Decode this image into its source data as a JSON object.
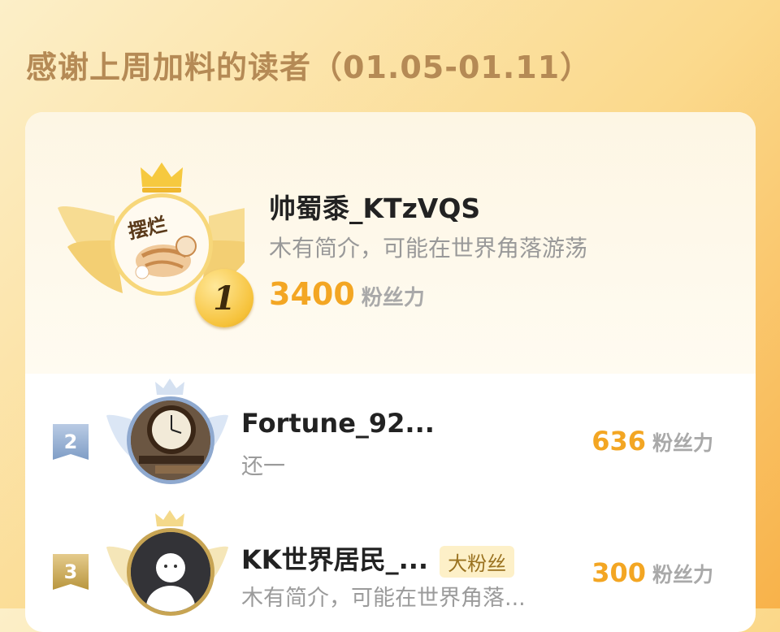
{
  "header": {
    "title": "感谢上周加料的读者（01.05-01.11）"
  },
  "first": {
    "rank": "1",
    "name": "帅蜀黍_KTzVQS",
    "bio": "木有简介，可能在世界角落游荡",
    "score": "3400",
    "score_unit": "粉丝力",
    "avatar_text": "摆烂"
  },
  "rows": [
    {
      "rank": "2",
      "name": "Fortune_92...",
      "bio": "还一",
      "score": "636",
      "score_unit": "粉丝力",
      "badge": ""
    },
    {
      "rank": "3",
      "name": "KK世界居民_...",
      "bio": "木有简介，可能在世界角落...",
      "score": "300",
      "score_unit": "粉丝力",
      "badge": "大粉丝"
    }
  ],
  "colors": {
    "gold": "#f3a623",
    "silver": "#8fa9cf",
    "bronze": "#c7a453"
  },
  "icons": [
    "crown-icon",
    "laurel-wings-icon",
    "rank-medal-icon"
  ]
}
